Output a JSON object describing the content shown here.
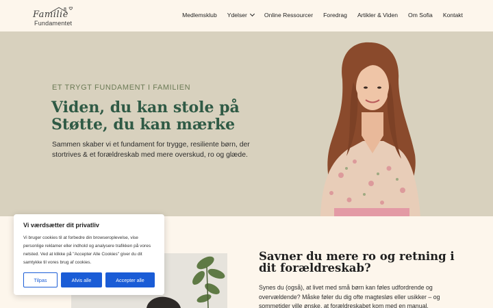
{
  "header": {
    "logo_script": "Familie",
    "logo_sub": "Fundamentet",
    "nav": [
      {
        "label": "Medlemsklub"
      },
      {
        "label": "Ydelser"
      },
      {
        "label": "Online Ressourcer"
      },
      {
        "label": "Foredrag"
      },
      {
        "label": "Artikler & Viden"
      },
      {
        "label": "Om Sofia"
      },
      {
        "label": "Kontakt"
      }
    ]
  },
  "hero": {
    "eyebrow": "ET TRYGT FUNDAMENT I FAMILIEN",
    "title_line1": "Viden, du kan stole på",
    "title_line2": "Støtte, du kan mærke",
    "body": "Sammen skaber vi et fundament for trygge, resiliente børn, der stortrives & et forældreskab med mere overskud, ro og glæde."
  },
  "section": {
    "title": "Savner du mere ro og retning i dit forældreskab?",
    "body": "Synes du (også), at livet med små børn kan føles udfordrende og overvældende? Måske føler du dig ofte magtesløs eller usikker – og sommetider ville ønske, at forældreskabet kom med en manual."
  },
  "cookie": {
    "title": "Vi værdsætter dit privatliv",
    "text": "Vi bruger cookies til at forbedre din browseroplevelse, vise personlige reklamer eller indhold og analysere trafikken på vores netsted. Ved at klikke på \"Accepter Alle Cookies\" giver du dit samtykke til vores brug af cookies.",
    "customize_label": "Tilpas",
    "reject_label": "Afvis alle",
    "accept_label": "Accepter alle"
  },
  "colors": {
    "accent_green": "#2f5a45",
    "eyebrow_green": "#6b7a55",
    "hero_bg": "#d8d1be",
    "page_bg": "#fdf6ec",
    "button_blue": "#1a5cd6"
  }
}
